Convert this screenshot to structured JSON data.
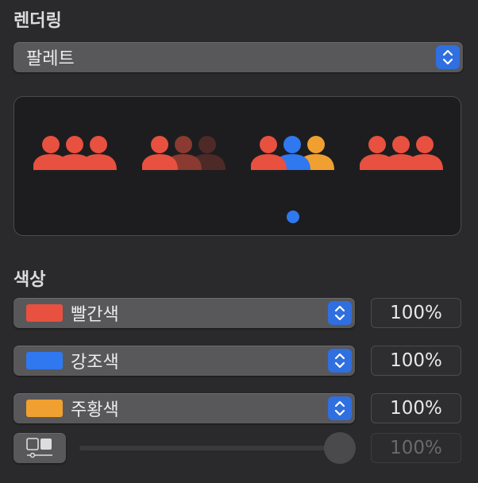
{
  "rendering": {
    "title": "렌더링",
    "mode_popup": {
      "value": "팔레트"
    },
    "preview": {
      "icons": [
        {
          "name": "red-palette-preview",
          "colors": [
            "#e8503f",
            "#e8503f",
            "#e8503f"
          ]
        },
        {
          "name": "monochrome-preview",
          "colors": [
            "#e8503f",
            "#8a3a30",
            "#4e2a26"
          ]
        },
        {
          "name": "multicolor-preview",
          "colors": [
            "#e8503f",
            "#2f78f0",
            "#f0a030"
          ]
        },
        {
          "name": "hierarchical-preview",
          "colors": [
            "#e8503f",
            "#e8503f",
            "#e8503f"
          ]
        }
      ],
      "selected_dot_color": "#2f78f0"
    }
  },
  "colors": {
    "title": "색상",
    "rows": [
      {
        "label": "빨간색",
        "swatch": "#e8503f",
        "opacity": "100%"
      },
      {
        "label": "강조색",
        "swatch": "#2f78f0",
        "opacity": "100%"
      },
      {
        "label": "주황색",
        "swatch": "#f0a030",
        "opacity": "100%"
      }
    ],
    "opacity_slider": {
      "value": 1.0,
      "field": "100%"
    }
  }
}
